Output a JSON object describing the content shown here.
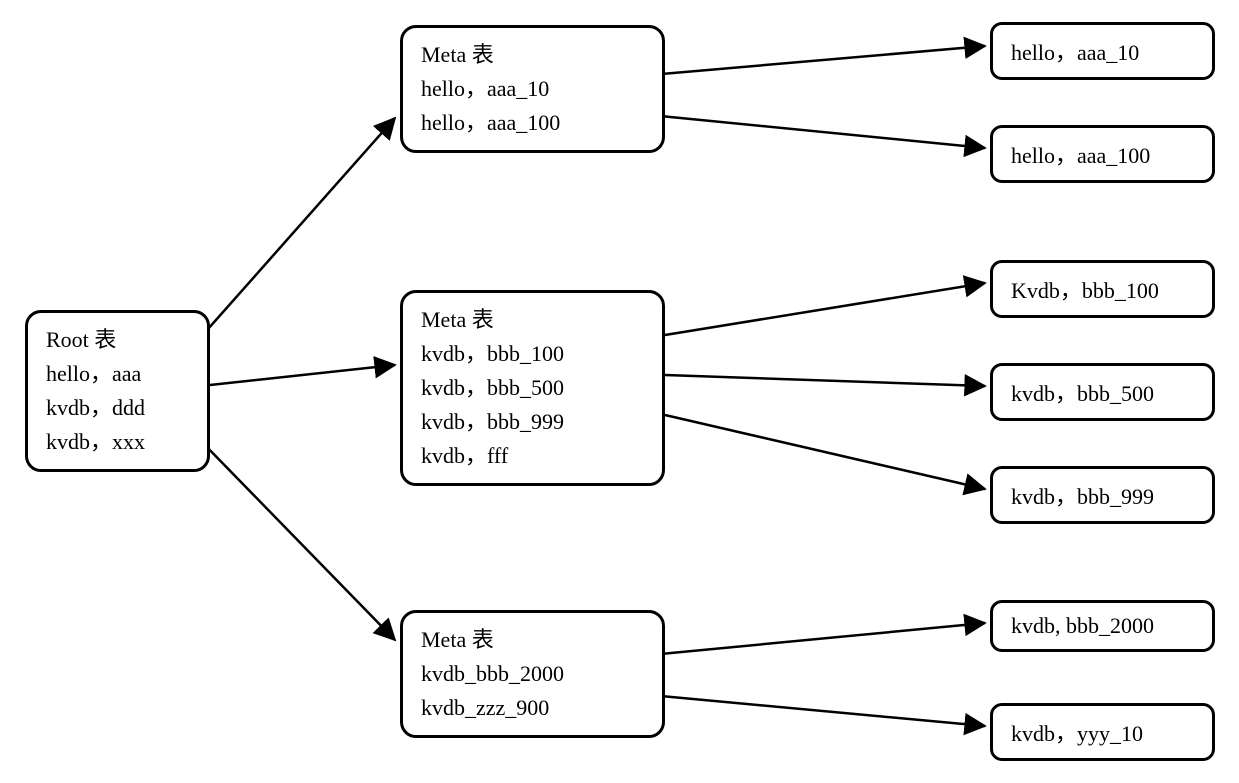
{
  "root": {
    "title": "Root 表",
    "lines": [
      "hello，aaa",
      "kvdb，ddd",
      "kvdb，xxx"
    ]
  },
  "meta": [
    {
      "title": "Meta 表",
      "lines": [
        "hello，aaa_10",
        "hello，aaa_100"
      ]
    },
    {
      "title": "Meta 表",
      "lines": [
        "kvdb，bbb_100",
        "kvdb，bbb_500",
        "kvdb，bbb_999",
        "kvdb，fff"
      ]
    },
    {
      "title": "Meta 表",
      "lines": [
        "kvdb_bbb_2000",
        "kvdb_zzz_900"
      ]
    }
  ],
  "leaves": [
    "hello，aaa_10",
    "hello，aaa_100",
    "Kvdb，bbb_100",
    "kvdb，bbb_500",
    "kvdb，bbb_999",
    "kvdb, bbb_2000",
    "kvdb，yyy_10"
  ]
}
